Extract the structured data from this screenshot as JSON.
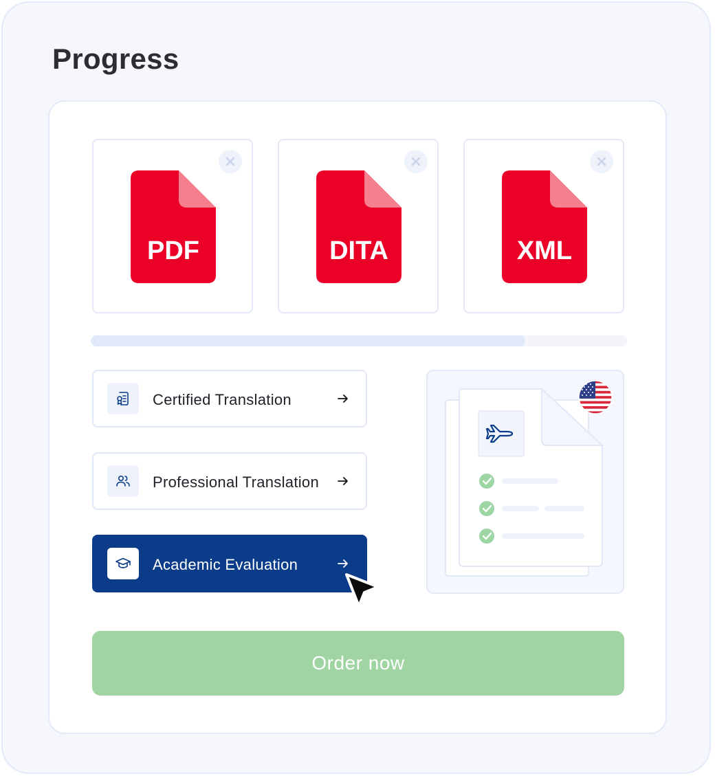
{
  "title": "Progress",
  "files": [
    {
      "label": "PDF"
    },
    {
      "label": "DITA"
    },
    {
      "label": "XML"
    }
  ],
  "upload_progress": 0.81,
  "services": [
    {
      "label": "Certified Translation",
      "icon": "certificate-icon",
      "active": false
    },
    {
      "label": "Professional Translation",
      "icon": "people-icon",
      "active": false
    },
    {
      "label": "Academic Evaluation",
      "icon": "graduation-cap-icon",
      "active": true
    }
  ],
  "preview": {
    "flag": "us-flag-icon",
    "doc_icon": "airplane-icon",
    "checklist_items": 3
  },
  "order_button": "Order now",
  "colors": {
    "file_red": "#eb0028",
    "active_blue": "#0a3c89",
    "order_green": "#a1d4a3",
    "check_green": "#9fd6a6"
  }
}
